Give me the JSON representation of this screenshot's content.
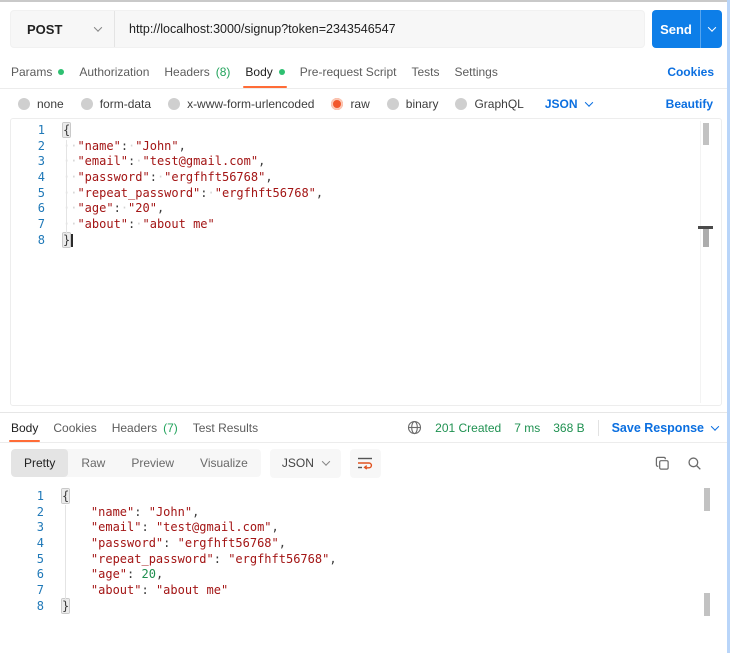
{
  "topbar": {
    "method": "POST",
    "url": "http://localhost:3000/signup?token=2343546547",
    "send_label": "Send"
  },
  "request_tabs": {
    "items": [
      {
        "label": "Params",
        "dot": true
      },
      {
        "label": "Authorization"
      },
      {
        "label": "Headers",
        "count": "(8)"
      },
      {
        "label": "Body",
        "dot": true,
        "active": true
      },
      {
        "label": "Pre-request Script"
      },
      {
        "label": "Tests"
      },
      {
        "label": "Settings"
      }
    ],
    "cookies_link": "Cookies"
  },
  "body_modes": {
    "options": [
      {
        "label": "none"
      },
      {
        "label": "form-data"
      },
      {
        "label": "x-www-form-urlencoded"
      },
      {
        "label": "raw",
        "selected": true
      },
      {
        "label": "binary"
      },
      {
        "label": "GraphQL"
      }
    ],
    "language": "JSON",
    "beautify_link": "Beautify"
  },
  "request_editor": {
    "lines": [
      {
        "n": 1,
        "tokens": [
          {
            "t": "b",
            "v": "{"
          }
        ]
      },
      {
        "n": 2,
        "tokens": [
          {
            "t": "w",
            "v": "··"
          },
          {
            "t": "k",
            "v": "\"name\""
          },
          {
            "t": "p",
            "v": ":"
          },
          {
            "t": "w",
            "v": "·"
          },
          {
            "t": "s",
            "v": "\"John\""
          },
          {
            "t": "p",
            "v": ","
          }
        ]
      },
      {
        "n": 3,
        "tokens": [
          {
            "t": "w",
            "v": "··"
          },
          {
            "t": "k",
            "v": "\"email\""
          },
          {
            "t": "p",
            "v": ":"
          },
          {
            "t": "w",
            "v": "·"
          },
          {
            "t": "s",
            "v": "\"test@gmail.com\""
          },
          {
            "t": "p",
            "v": ","
          }
        ]
      },
      {
        "n": 4,
        "tokens": [
          {
            "t": "w",
            "v": "··"
          },
          {
            "t": "k",
            "v": "\"password\""
          },
          {
            "t": "p",
            "v": ":"
          },
          {
            "t": "w",
            "v": "·"
          },
          {
            "t": "s",
            "v": "\"ergfhft56768\""
          },
          {
            "t": "p",
            "v": ","
          }
        ]
      },
      {
        "n": 5,
        "tokens": [
          {
            "t": "w",
            "v": "··"
          },
          {
            "t": "k",
            "v": "\"repeat_password\""
          },
          {
            "t": "p",
            "v": ":"
          },
          {
            "t": "w",
            "v": "·"
          },
          {
            "t": "s",
            "v": "\"ergfhft56768\""
          },
          {
            "t": "p",
            "v": ","
          }
        ]
      },
      {
        "n": 6,
        "tokens": [
          {
            "t": "w",
            "v": "··"
          },
          {
            "t": "k",
            "v": "\"age\""
          },
          {
            "t": "p",
            "v": ":"
          },
          {
            "t": "w",
            "v": "·"
          },
          {
            "t": "s",
            "v": "\"20\""
          },
          {
            "t": "p",
            "v": ","
          }
        ]
      },
      {
        "n": 7,
        "tokens": [
          {
            "t": "w",
            "v": "··"
          },
          {
            "t": "k",
            "v": "\"about\""
          },
          {
            "t": "p",
            "v": ":"
          },
          {
            "t": "w",
            "v": "·"
          },
          {
            "t": "s",
            "v": "\"about me\""
          }
        ]
      },
      {
        "n": 8,
        "tokens": [
          {
            "t": "b",
            "v": "}"
          },
          {
            "t": "cur",
            "v": ""
          }
        ]
      }
    ]
  },
  "response_bar": {
    "tabs": [
      {
        "label": "Body",
        "active": true
      },
      {
        "label": "Cookies"
      },
      {
        "label": "Headers",
        "count": "(7)"
      },
      {
        "label": "Test Results"
      }
    ],
    "status": "201 Created",
    "time": "7 ms",
    "size": "368 B",
    "save_label": "Save Response"
  },
  "response_view": {
    "modes": [
      {
        "label": "Pretty",
        "selected": true
      },
      {
        "label": "Raw"
      },
      {
        "label": "Preview"
      },
      {
        "label": "Visualize"
      }
    ],
    "language": "JSON"
  },
  "response_editor": {
    "lines": [
      {
        "n": 1,
        "tokens": [
          {
            "t": "b",
            "v": "{"
          }
        ]
      },
      {
        "n": 2,
        "tokens": [
          {
            "t": "p",
            "v": "    "
          },
          {
            "t": "k",
            "v": "\"name\""
          },
          {
            "t": "p",
            "v": ": "
          },
          {
            "t": "s",
            "v": "\"John\""
          },
          {
            "t": "p",
            "v": ","
          }
        ]
      },
      {
        "n": 3,
        "tokens": [
          {
            "t": "p",
            "v": "    "
          },
          {
            "t": "k",
            "v": "\"email\""
          },
          {
            "t": "p",
            "v": ": "
          },
          {
            "t": "s",
            "v": "\"test@gmail.com\""
          },
          {
            "t": "p",
            "v": ","
          }
        ]
      },
      {
        "n": 4,
        "tokens": [
          {
            "t": "p",
            "v": "    "
          },
          {
            "t": "k",
            "v": "\"password\""
          },
          {
            "t": "p",
            "v": ": "
          },
          {
            "t": "s",
            "v": "\"ergfhft56768\""
          },
          {
            "t": "p",
            "v": ","
          }
        ]
      },
      {
        "n": 5,
        "tokens": [
          {
            "t": "p",
            "v": "    "
          },
          {
            "t": "k",
            "v": "\"repeat_password\""
          },
          {
            "t": "p",
            "v": ": "
          },
          {
            "t": "s",
            "v": "\"ergfhft56768\""
          },
          {
            "t": "p",
            "v": ","
          }
        ]
      },
      {
        "n": 6,
        "tokens": [
          {
            "t": "p",
            "v": "    "
          },
          {
            "t": "k",
            "v": "\"age\""
          },
          {
            "t": "p",
            "v": ": "
          },
          {
            "t": "n",
            "v": "20"
          },
          {
            "t": "p",
            "v": ","
          }
        ]
      },
      {
        "n": 7,
        "tokens": [
          {
            "t": "p",
            "v": "    "
          },
          {
            "t": "k",
            "v": "\"about\""
          },
          {
            "t": "p",
            "v": ": "
          },
          {
            "t": "s",
            "v": "\"about me\""
          }
        ]
      },
      {
        "n": 8,
        "tokens": [
          {
            "t": "b",
            "v": "}"
          }
        ]
      }
    ]
  },
  "colors": {
    "accent_orange": "#ff6c37",
    "link_blue": "#0b6fe0",
    "send_blue": "#0d7ee8",
    "status_green": "#1f9151",
    "dot_green": "#2ec071",
    "line_number_blue": "#2079b8",
    "json_string_red": "#a31515",
    "json_number_green": "#1e8e4e"
  }
}
